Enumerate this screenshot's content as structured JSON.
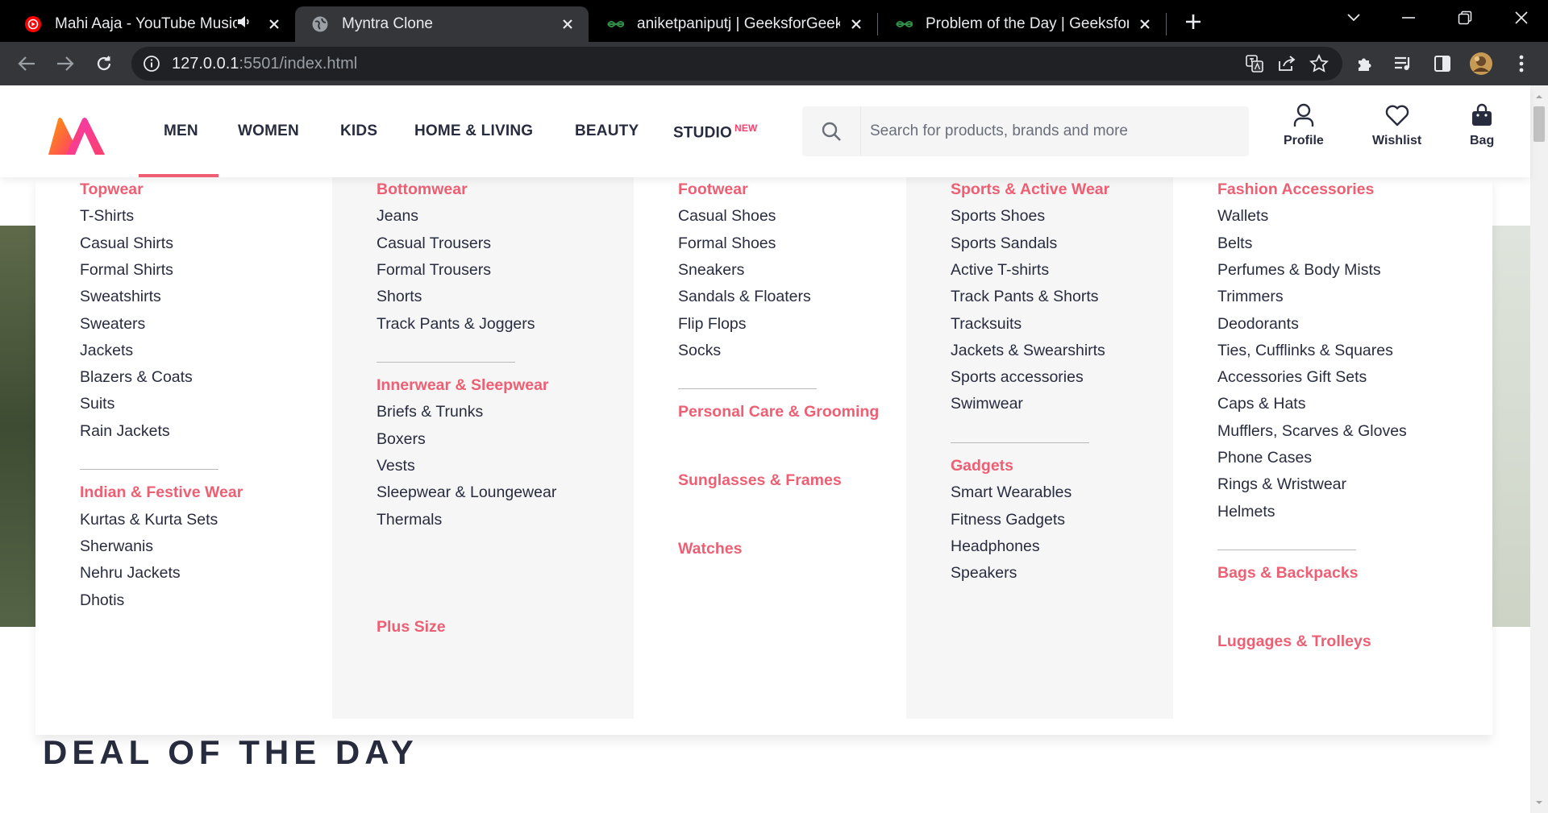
{
  "browser": {
    "tabs": [
      {
        "title": "Mahi Aaja - YouTube Music",
        "icon": "youtube-music-icon",
        "audio": true
      },
      {
        "title": "Myntra Clone",
        "icon": "globe-icon",
        "active": true
      },
      {
        "title": "aniketpaniputj | GeeksforGeeks P",
        "icon": "gfg-icon"
      },
      {
        "title": "Problem of the Day | GeeksforGe",
        "icon": "gfg-icon"
      }
    ],
    "url_host": "127.0.0.1",
    "url_rest": ":5501/index.html"
  },
  "header": {
    "nav": [
      {
        "label": "MEN"
      },
      {
        "label": "WOMEN"
      },
      {
        "label": "KIDS"
      },
      {
        "label": "HOME & LIVING"
      },
      {
        "label": "BEAUTY"
      },
      {
        "label": "STUDIO",
        "badge": "NEW"
      }
    ],
    "search_placeholder": "Search for products, brands and more",
    "actions": [
      {
        "label": "Profile",
        "icon": "user-icon"
      },
      {
        "label": "Wishlist",
        "icon": "heart-icon"
      },
      {
        "label": "Bag",
        "icon": "bag-icon"
      }
    ]
  },
  "mega_menu": {
    "columns": [
      {
        "sections": [
          {
            "title": "Topwear",
            "items": [
              "T-Shirts",
              "Casual Shirts",
              "Formal Shirts",
              "Sweatshirts",
              "Sweaters",
              "Jackets",
              "Blazers & Coats",
              "Suits",
              "Rain Jackets"
            ]
          },
          {
            "title": "Indian & Festive Wear",
            "items": [
              "Kurtas & Kurta Sets",
              "Sherwanis",
              "Nehru Jackets",
              "Dhotis"
            ]
          }
        ]
      },
      {
        "sections": [
          {
            "title": "Bottomwear",
            "items": [
              "Jeans",
              "Casual Trousers",
              "Formal Trousers",
              "Shorts",
              "Track Pants & Joggers"
            ]
          },
          {
            "title": "Innerwear & Sleepwear",
            "items": [
              "Briefs & Trunks",
              "Boxers",
              "Vests",
              "Sleepwear & Loungewear",
              "Thermals"
            ]
          },
          {
            "title": "Plus Size",
            "items": []
          }
        ]
      },
      {
        "sections": [
          {
            "title": "Footwear",
            "items": [
              "Casual Shoes",
              "Formal Shoes",
              "Sneakers",
              "Sandals & Floaters",
              "Flip Flops",
              "Socks"
            ]
          },
          {
            "title": "Personal Care & Grooming",
            "items": []
          },
          {
            "title": "Sunglasses & Frames",
            "items": []
          },
          {
            "title": "Watches",
            "items": []
          }
        ]
      },
      {
        "sections": [
          {
            "title": "Sports & Active Wear",
            "items": [
              "Sports Shoes",
              "Sports Sandals",
              "Active T-shirts",
              "Track Pants & Shorts",
              "Tracksuits",
              "Jackets & Swearshirts",
              "Sports accessories",
              "Swimwear"
            ]
          },
          {
            "title": "Gadgets",
            "items": [
              "Smart Wearables",
              "Fitness Gadgets",
              "Headphones",
              "Speakers"
            ]
          }
        ]
      },
      {
        "sections": [
          {
            "title": "Fashion Accessories",
            "items": [
              "Wallets",
              "Belts",
              "Perfumes & Body Mists",
              "Trimmers",
              "Deodorants",
              "Ties, Cufflinks & Squares",
              "Accessories Gift Sets",
              "Caps & Hats",
              "Mufflers, Scarves & Gloves",
              "Phone Cases",
              "Rings & Wristwear",
              "Helmets"
            ]
          },
          {
            "title": "Bags & Backpacks",
            "items": []
          },
          {
            "title": "Luggages & Trolleys",
            "items": []
          }
        ]
      }
    ]
  },
  "deal_heading": "DEAL OF THE DAY",
  "colors": {
    "accent": "#ee5f73",
    "text": "#282c3f",
    "badge": "#ff3f6c"
  }
}
